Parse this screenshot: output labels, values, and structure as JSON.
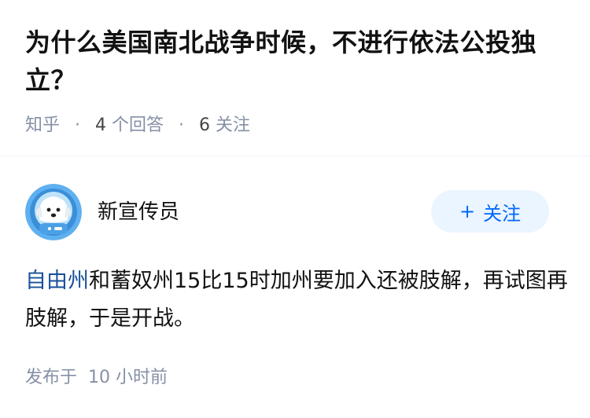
{
  "question": {
    "title": "为什么美国南北战争时候，不进行依法公投独立？",
    "source": "知乎",
    "answer_count": "4",
    "answer_label": "个回答",
    "follower_count": "6",
    "follower_label": "关注"
  },
  "author": {
    "name": "新宣传员",
    "avatar_icon": "astronaut-dog-avatar",
    "follow_plus": "+",
    "follow_label": "关注"
  },
  "answer": {
    "link_text": "自由州",
    "body": "和蓄奴州15比15时加州要加入还被肢解，再试图再肢解，于是开战。"
  },
  "footer": {
    "published_label": "发布于",
    "time": "10 小时前"
  },
  "colors": {
    "link": "#175199",
    "follow_text": "#0066ff",
    "follow_bg": "#ebf5ff",
    "muted": "#8590a6"
  }
}
